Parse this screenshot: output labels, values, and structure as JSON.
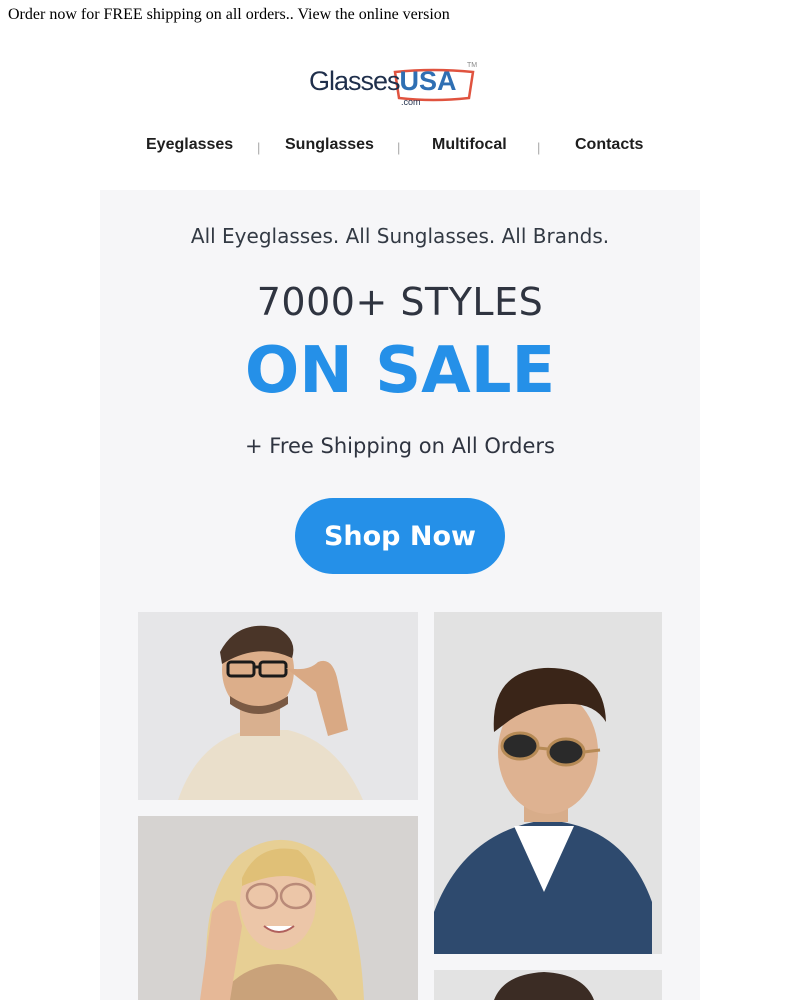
{
  "preheader": {
    "text": "Order now for FREE shipping on all orders.. View the online version"
  },
  "logo": {
    "main": "Glasses",
    "usa": "USA",
    "com": ".com",
    "tm": "TM"
  },
  "nav": {
    "items": [
      "Eyeglasses",
      "Sunglasses",
      "Multifocal",
      "Contacts"
    ],
    "separator": "|"
  },
  "hero": {
    "tagline": "All Eyeglasses. All Sunglasses. All Brands.",
    "styles": "7000+ STYLES",
    "sale": "ON SALE",
    "shipping": "+ Free Shipping on All Orders",
    "cta": "Shop Now"
  },
  "photos": [
    {
      "icon": "man-eyeglasses-photo"
    },
    {
      "icon": "man-sunglasses-photo"
    },
    {
      "icon": "woman-eyeglasses-photo"
    },
    {
      "icon": "partial-model-photo"
    }
  ],
  "colors": {
    "accent": "#2590e8",
    "hero_bg": "#f6f6f8",
    "text_dark": "#2f3440"
  }
}
